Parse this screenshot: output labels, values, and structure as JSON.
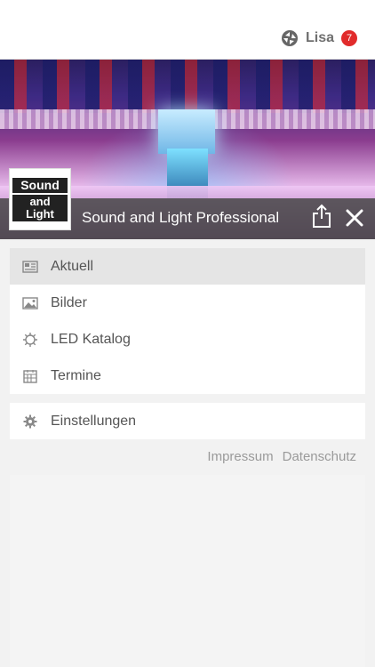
{
  "user": {
    "name": "Lisa",
    "badge_count": "7"
  },
  "brand": {
    "logo_line1": "Sound",
    "logo_line2": "and Light",
    "title": "Sound and Light Professional"
  },
  "menu": {
    "items": [
      {
        "label": "Aktuell",
        "icon": "newspaper-icon"
      },
      {
        "label": "Bilder",
        "icon": "image-icon"
      },
      {
        "label": "LED Katalog",
        "icon": "gear-outline-icon"
      },
      {
        "label": "Termine",
        "icon": "calendar-icon"
      }
    ],
    "settings": {
      "label": "Einstellungen",
      "icon": "settings-icon"
    }
  },
  "footer": {
    "impressum": "Impressum",
    "datenschutz": "Datenschutz"
  },
  "colors": {
    "badge": "#e12b2b",
    "bar": "#464646"
  }
}
